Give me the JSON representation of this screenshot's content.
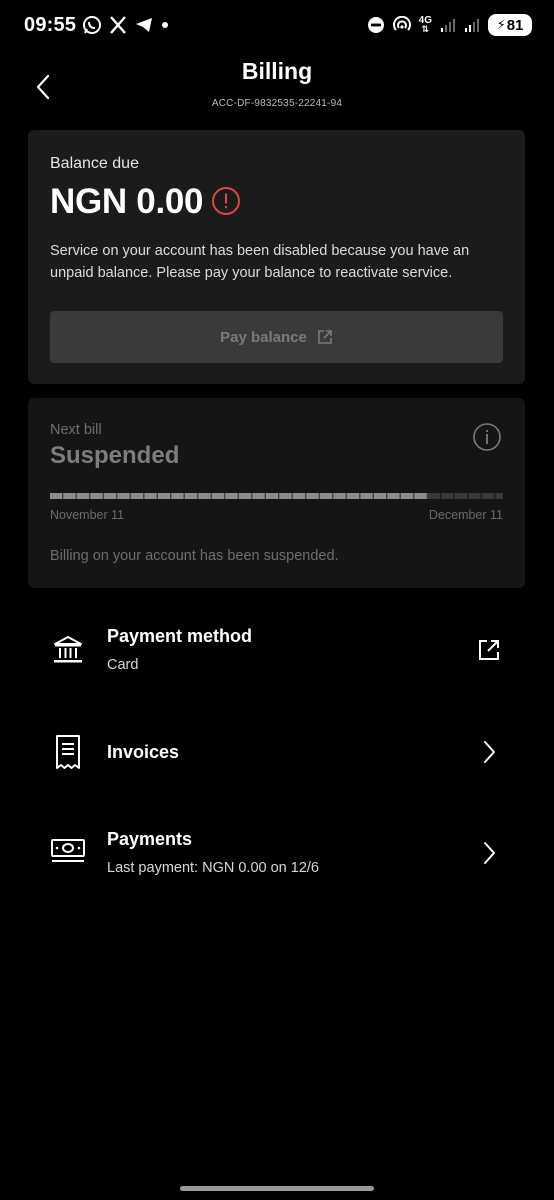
{
  "status_bar": {
    "time": "09:55",
    "left_icons": [
      "whatsapp-icon",
      "x-icon",
      "telegram-icon",
      "dot-icon"
    ],
    "right_icons": [
      "do-not-disturb-icon",
      "hotspot-icon",
      "4g-icon",
      "signal-icon",
      "signal-icon",
      "battery-icon"
    ],
    "network_label": "4G",
    "battery_level": "81"
  },
  "header": {
    "title": "Billing",
    "account_id": "ACC-DF-9832535-22241-94"
  },
  "balance": {
    "label": "Balance due",
    "amount": "NGN 0.00",
    "message": "Service on your account has been disabled because you have an unpaid balance. Please pay your balance to reactivate service.",
    "pay_button_label": "Pay balance",
    "alert_color": "#e0463f"
  },
  "next_bill": {
    "label": "Next bill",
    "status": "Suspended",
    "period_start": "November 11",
    "period_end": "December 11",
    "progress_fraction": 0.835,
    "note": "Billing on your account has been suspended."
  },
  "menu": {
    "payment_method": {
      "title": "Payment method",
      "subtitle": "Card",
      "icon": "bank-icon",
      "action_icon": "external-link-icon"
    },
    "invoices": {
      "title": "Invoices",
      "icon": "receipt-icon",
      "action_icon": "chevron-right-icon"
    },
    "payments": {
      "title": "Payments",
      "subtitle": "Last payment: NGN 0.00 on 12/6",
      "icon": "cash-icon",
      "action_icon": "chevron-right-icon"
    }
  }
}
